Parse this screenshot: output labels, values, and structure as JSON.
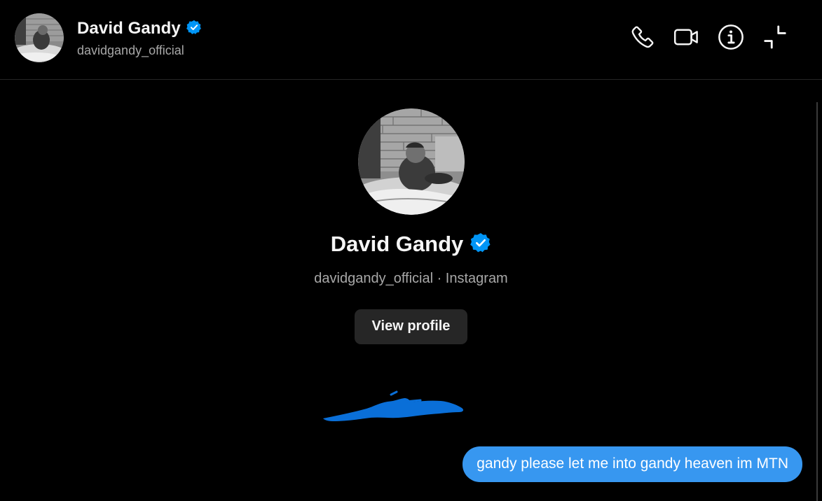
{
  "header": {
    "name": "David Gandy",
    "username": "davidgandy_official",
    "verified": true,
    "actions": [
      {
        "name": "phone-call",
        "icon": "phone-icon"
      },
      {
        "name": "video-call",
        "icon": "video-camera-icon"
      },
      {
        "name": "conversation-info",
        "icon": "info-icon"
      },
      {
        "name": "minimize",
        "icon": "collapse-icon"
      }
    ]
  },
  "profile": {
    "name": "David Gandy",
    "subtitle": "davidgandy_official · Instagram",
    "view_profile_label": "View profile",
    "verified": true
  },
  "messages": [
    {
      "direction": "outgoing",
      "text": "gandy please let me into gandy heaven im MTN"
    }
  ],
  "colors": {
    "background": "#000000",
    "bubble_outgoing": "#3797f0",
    "verified_badge": "#0095f6",
    "button_bg": "#262626",
    "secondary_text": "#a8a8a8",
    "redaction": "#0a6fd8"
  }
}
